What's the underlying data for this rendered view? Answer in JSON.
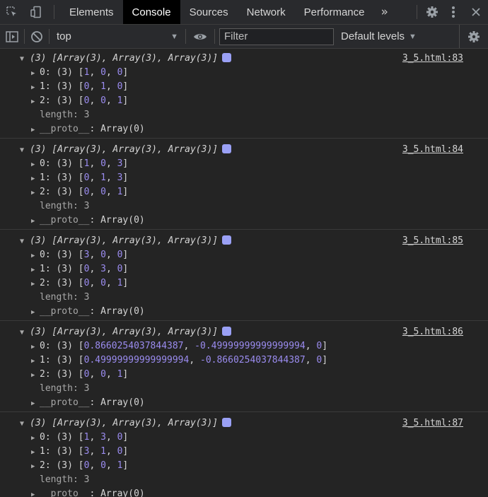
{
  "tabs": {
    "items": [
      "Elements",
      "Console",
      "Sources",
      "Network",
      "Performance"
    ],
    "active": "Console",
    "more": "»"
  },
  "toolbar": {
    "context": "top",
    "filter_placeholder": "Filter",
    "levels": "Default levels"
  },
  "groups": [
    {
      "header": "(3) [Array(3), Array(3), Array(3)]",
      "source": "3_5.html:83",
      "rows": [
        {
          "key": "0: (3) ",
          "values": [
            "1",
            "0",
            "0"
          ]
        },
        {
          "key": "1: (3) ",
          "values": [
            "0",
            "1",
            "0"
          ]
        },
        {
          "key": "2: (3) ",
          "values": [
            "0",
            "0",
            "1"
          ]
        }
      ]
    },
    {
      "header": "(3) [Array(3), Array(3), Array(3)]",
      "source": "3_5.html:84",
      "rows": [
        {
          "key": "0: (3) ",
          "values": [
            "1",
            "0",
            "3"
          ]
        },
        {
          "key": "1: (3) ",
          "values": [
            "0",
            "1",
            "3"
          ]
        },
        {
          "key": "2: (3) ",
          "values": [
            "0",
            "0",
            "1"
          ]
        }
      ]
    },
    {
      "header": "(3) [Array(3), Array(3), Array(3)]",
      "source": "3_5.html:85",
      "rows": [
        {
          "key": "0: (3) ",
          "values": [
            "3",
            "0",
            "0"
          ]
        },
        {
          "key": "1: (3) ",
          "values": [
            "0",
            "3",
            "0"
          ]
        },
        {
          "key": "2: (3) ",
          "values": [
            "0",
            "0",
            "1"
          ]
        }
      ]
    },
    {
      "header": "(3) [Array(3), Array(3), Array(3)]",
      "source": "3_5.html:86",
      "rows": [
        {
          "key": "0: (3) ",
          "values": [
            "0.8660254037844387",
            "-0.49999999999999994",
            "0"
          ]
        },
        {
          "key": "1: (3) ",
          "values": [
            "0.49999999999999994",
            "-0.8660254037844387",
            "0"
          ]
        },
        {
          "key": "2: (3) ",
          "values": [
            "0",
            "0",
            "1"
          ]
        }
      ]
    },
    {
      "header": "(3) [Array(3), Array(3), Array(3)]",
      "source": "3_5.html:87",
      "rows": [
        {
          "key": "0: (3) ",
          "values": [
            "1",
            "3",
            "0"
          ]
        },
        {
          "key": "1: (3) ",
          "values": [
            "3",
            "1",
            "0"
          ]
        },
        {
          "key": "2: (3) ",
          "values": [
            "0",
            "0",
            "1"
          ]
        }
      ]
    }
  ],
  "length_label": "length: 3",
  "proto_label": "__proto__",
  "proto_value": ": Array(0)"
}
